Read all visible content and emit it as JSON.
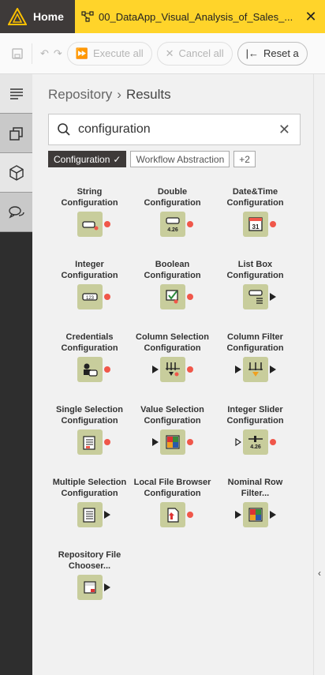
{
  "tabs": {
    "home_label": "Home",
    "workflow_label": "00_DataApp_Visual_Analysis_of_Sales_..."
  },
  "toolbar": {
    "execute_all": "Execute all",
    "cancel_all": "Cancel all",
    "reset_all": "Reset a"
  },
  "breadcrumb": {
    "root": "Repository",
    "separator": "›",
    "current": "Results"
  },
  "search": {
    "value": "configuration"
  },
  "tags": {
    "selected": "Configuration",
    "other": "Workflow Abstraction",
    "more": "+2"
  },
  "nodes": [
    {
      "line1": "String",
      "line2": "Configuration",
      "icon": "string-config-icon",
      "in": "none",
      "out": "flow-variable"
    },
    {
      "line1": "Double",
      "line2": "Configuration",
      "icon": "double-config-icon",
      "in": "none",
      "out": "flow-variable"
    },
    {
      "line1": "Date&Time",
      "line2": "Configuration",
      "icon": "datetime-config-icon",
      "in": "none",
      "out": "flow-variable"
    },
    {
      "line1": "Integer",
      "line2": "Configuration",
      "icon": "integer-config-icon",
      "in": "none",
      "out": "flow-variable"
    },
    {
      "line1": "Boolean",
      "line2": "Configuration",
      "icon": "boolean-config-icon",
      "in": "none",
      "out": "flow-variable"
    },
    {
      "line1": "List Box",
      "line2": "Configuration",
      "icon": "listbox-config-icon",
      "in": "none",
      "out": "table"
    },
    {
      "line1": "Credentials",
      "line2": "Configuration",
      "icon": "credentials-config-icon",
      "in": "none",
      "out": "flow-variable"
    },
    {
      "line1": "Column Selection",
      "line2": "Configuration",
      "icon": "column-selection-config-icon",
      "in": "table",
      "out": "flow-variable"
    },
    {
      "line1": "Column Filter",
      "line2": "Configuration",
      "icon": "column-filter-config-icon",
      "in": "table",
      "out": "table"
    },
    {
      "line1": "Single Selection",
      "line2": "Configuration",
      "icon": "single-selection-config-icon",
      "in": "none",
      "out": "flow-variable"
    },
    {
      "line1": "Value Selection",
      "line2": "Configuration",
      "icon": "value-selection-config-icon",
      "in": "table",
      "out": "flow-variable"
    },
    {
      "line1": "Integer Slider",
      "line2": "Configuration",
      "icon": "integer-slider-config-icon",
      "in": "hollow",
      "out": "flow-variable"
    },
    {
      "line1": "Multiple Selection",
      "line2": "Configuration",
      "icon": "multiple-selection-config-icon",
      "in": "none",
      "out": "table"
    },
    {
      "line1": "Local File Browser",
      "line2": "Configuration",
      "icon": "local-file-browser-config-icon",
      "in": "none",
      "out": "flow-variable"
    },
    {
      "line1": "Nominal Row",
      "line2": "Filter...",
      "icon": "nominal-row-filter-icon",
      "in": "table",
      "out": "table"
    },
    {
      "line1": "Repository File",
      "line2": "Chooser...",
      "icon": "repository-file-chooser-icon",
      "in": "none",
      "out": "table"
    }
  ],
  "colors": {
    "tab_bar": "#fcc000",
    "home_tab": "#3e3a39",
    "node_box": "#c8cd9c",
    "flow_variable_port": "#f0574a"
  }
}
